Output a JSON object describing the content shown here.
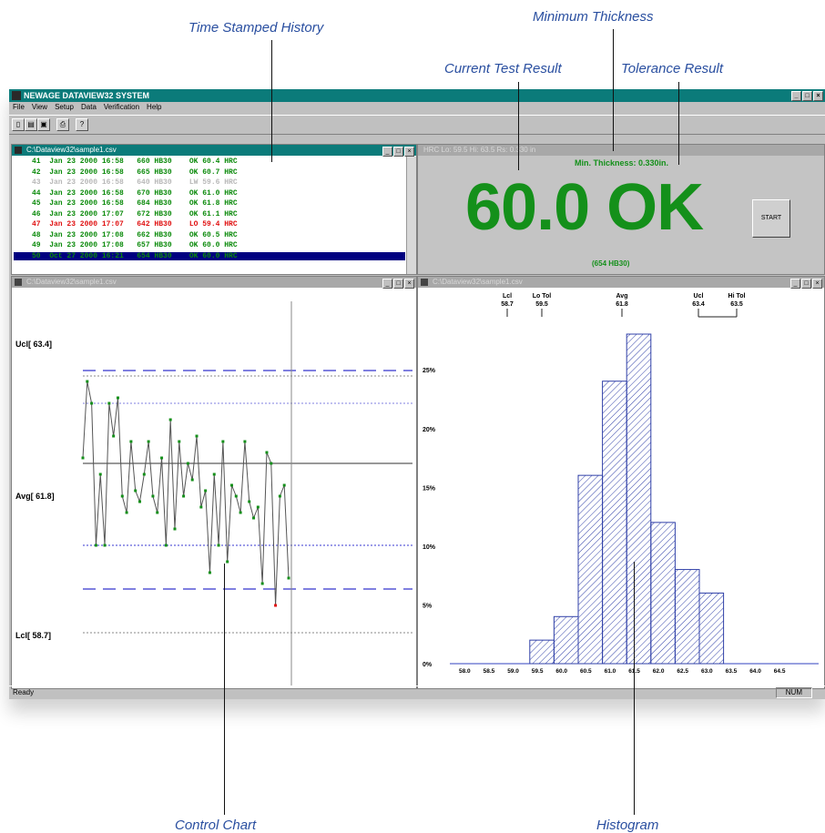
{
  "callouts": {
    "history": "Time Stamped History",
    "min_thickness": "Minimum Thickness",
    "current": "Current Test Result",
    "tolerance": "Tolerance Result",
    "control": "Control Chart",
    "histogram": "Histogram"
  },
  "app": {
    "title": "NEWAGE DATAVIEW32 SYSTEM",
    "menu": [
      "File",
      "View",
      "Setup",
      "Data",
      "Verification",
      "Help"
    ],
    "status": "Ready",
    "status_num": "NUM"
  },
  "history": {
    "title": "C:\\Dataview32\\sample1.csv",
    "rows": [
      {
        "text": "41  Jan 23 2000 16:58   660 HB30    OK 60.4 HRC",
        "color": "#0a8a0a"
      },
      {
        "text": "42  Jan 23 2000 16:58   665 HB30    OK 60.7 HRC",
        "color": "#0a8a0a"
      },
      {
        "text": "43  Jan 23 2000 16:58   640 HB30    LW 59.6 HRC",
        "color": "#b8b8b8"
      },
      {
        "text": "44  Jan 23 2000 16:58   670 HB30    OK 61.0 HRC",
        "color": "#0a8a0a"
      },
      {
        "text": "45  Jan 23 2000 16:58   684 HB30    OK 61.8 HRC",
        "color": "#0a8a0a"
      },
      {
        "text": "46  Jan 23 2000 17:07   672 HB30    OK 61.1 HRC",
        "color": "#0a8a0a"
      },
      {
        "text": "47  Jan 23 2000 17:07   642 HB30    LO 59.4 HRC",
        "color": "#e01010"
      },
      {
        "text": "48  Jan 23 2000 17:08   662 HB30    OK 60.5 HRC",
        "color": "#0a8a0a"
      },
      {
        "text": "49  Jan 23 2000 17:08   657 HB30    OK 60.0 HRC",
        "color": "#0a8a0a"
      },
      {
        "text": "50  Oct 27 2000 16:21   654 HB30    OK 60.0 HRC",
        "color": "#0a8a0a"
      }
    ]
  },
  "result": {
    "header": "HRC     Lo: 59.5     Hi: 63.5     Rs: 0.330 in",
    "min_thickness": "Min. Thickness: 0.330in.",
    "value": "60.0 OK",
    "sub": "(654 HB30)",
    "start": "START"
  },
  "control_chart": {
    "title": "C:\\Dataview32\\sample1.csv",
    "labels": {
      "ucl": "Ucl[ 63.4]",
      "avg": "Avg[ 61.8]",
      "lcl": "Lcl[ 58.7]"
    },
    "ucl": 63.4,
    "avg": 61.8,
    "lcl": 58.7,
    "hi_tol": 63.5,
    "lo_tol": 59.5,
    "ylim": [
      58.5,
      64.5
    ],
    "values": [
      61.9,
      63.3,
      62.9,
      60.3,
      61.6,
      60.3,
      62.9,
      62.3,
      63.0,
      61.2,
      60.9,
      62.2,
      61.3,
      61.1,
      61.6,
      62.2,
      61.2,
      60.9,
      61.9,
      60.3,
      62.6,
      60.6,
      62.2,
      61.2,
      61.8,
      61.5,
      62.3,
      61.0,
      61.3,
      59.8,
      61.6,
      60.3,
      62.2,
      60.0,
      61.4,
      61.2,
      60.9,
      62.2,
      61.1,
      60.8,
      61.0,
      59.6,
      62.0,
      61.8,
      59.2,
      61.2,
      61.4,
      59.7
    ]
  },
  "histogram": {
    "title": "C:\\Dataview32\\sample1.csv",
    "stats": [
      {
        "label": "Lcl",
        "value": "58.7"
      },
      {
        "label": "Lo Tol",
        "value": "59.5"
      },
      {
        "label": "Avg",
        "value": "61.8"
      },
      {
        "label": "Ucl",
        "value": "63.4"
      },
      {
        "label": "Hi Tol",
        "value": "63.5"
      }
    ],
    "y_ticks": [
      "25%",
      "20%",
      "15%",
      "10%",
      "5%",
      "0%"
    ],
    "x_ticks": [
      "58.0",
      "58.5",
      "59.0",
      "59.5",
      "60.0",
      "60.5",
      "61.0",
      "61.5",
      "62.0",
      "62.5",
      "63.0",
      "63.5",
      "64.0",
      "64.5"
    ]
  },
  "chart_data": {
    "type": "bar",
    "categories": [
      "58.0",
      "58.5",
      "59.0",
      "59.5",
      "60.0",
      "60.5",
      "61.0",
      "61.5",
      "62.0",
      "62.5",
      "63.0",
      "63.5",
      "64.0",
      "64.5"
    ],
    "values": [
      0,
      0,
      0,
      2,
      4,
      16,
      24,
      28,
      12,
      8,
      6,
      0,
      0,
      0
    ],
    "ylim": [
      0,
      28
    ],
    "ylabel": ""
  },
  "colors": {
    "titlebar": "#0b7b7a",
    "ok": "#14901a",
    "limit": "#8080e0",
    "selected": "#000080"
  }
}
